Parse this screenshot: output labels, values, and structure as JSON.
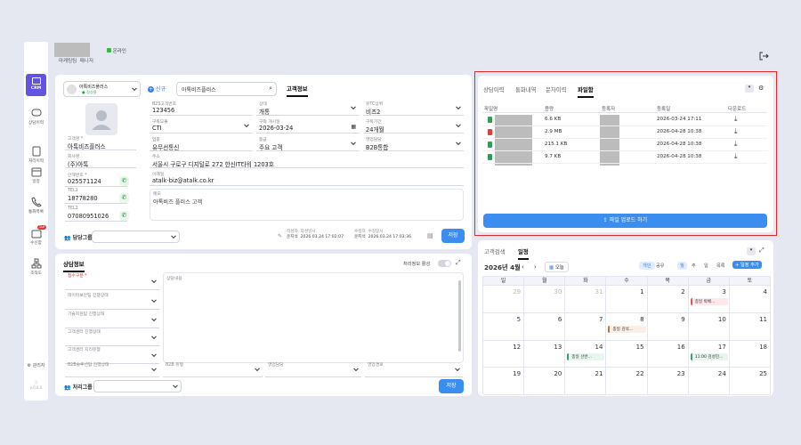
{
  "header": {
    "menu": [
      "마케팅팀",
      "매니저"
    ],
    "status": "온라인"
  },
  "sidebar": {
    "items": [
      "CRM",
      "상담이력",
      "처리이력",
      "일정",
      "통화목록",
      "수신함",
      "조직도"
    ],
    "badge": "53",
    "admin": "관리자",
    "version": "v.0.0.0"
  },
  "customer": {
    "company_select": "아톡비즈플러스",
    "company_sub": "● 정상용",
    "new_label": "신규",
    "search_value": "아톡비즈플러스",
    "tab": "고객정보",
    "fields": [
      {
        "label": "B2S고객번호",
        "value": "123456"
      },
      {
        "label": "상태",
        "value": "개통"
      },
      {
        "label": "유TC상위",
        "value": "비즈2"
      },
      {
        "label": "구독모듈",
        "value": "CTI"
      },
      {
        "label": "구독 개시일",
        "value": "2026-03-24"
      },
      {
        "label": "구독기간",
        "value": "24개월"
      },
      {
        "label": "업종",
        "value": "유무선통신"
      },
      {
        "label": "등급",
        "value": "주요 고객"
      },
      {
        "label": "영업담당",
        "value": "B2B통합"
      }
    ],
    "name_label": "고객명 *",
    "name": "아톡비즈플러스",
    "company_label": "회사명",
    "company": "(주)아톡",
    "phone_label": "안해번호 *",
    "phone": "025571124",
    "tel1_label": "TEL1",
    "tel1": "18778280",
    "tel2_label": "TEL2",
    "tel2": "07080951026",
    "address_label": "주소",
    "address": "서울시 구로구 디지털로 272 한신IT타워 1203호",
    "email_label": "이메일",
    "email": "atalk-biz@atalk.co.kr",
    "memo_label": "메모",
    "memo": "아톡비즈 플러스 고객",
    "group_label": "담당그룹",
    "reg_label": "작성자",
    "reg_sub": "작성일시",
    "reg_user": "운지석",
    "reg_date": "2026.03.24 17:02:07",
    "mod_label": "수정자",
    "mod_sub": "수정일시",
    "mod_user": "운지석",
    "mod_date": "2026.03.24 17:03:36",
    "save": "저장"
  },
  "consult": {
    "title": "상담정보",
    "toggle_label": "처리정보 활성",
    "fields": [
      "접수구분 *",
      "데이터보안팀 진행상태",
      "기술지원팀 진행상태",
      "고객센터 진행상태",
      "고객센터 지리유형"
    ],
    "content_label": "상담내용",
    "bottom": [
      "B2B솔루션팀 진행상태",
      "B2B 유형",
      "영업담당",
      "영업경로"
    ],
    "group_label": "처리그룹",
    "save": "저장"
  },
  "files": {
    "tabs": [
      "상담이력",
      "통화내역",
      "문자이력",
      "파일함"
    ],
    "active_tab": "파일함",
    "columns": [
      "파일명",
      "용량",
      "등록자",
      "등록일",
      "다운로드"
    ],
    "rows": [
      {
        "size": "6.6 KB",
        "date": "2026-03-24 17:11",
        "color": "#2e9b57"
      },
      {
        "size": "2.9 MB",
        "date": "2026-04-28 10:38",
        "color": "#d9413a"
      },
      {
        "size": "215.1 KB",
        "date": "2026-04-28 10:38",
        "color": "#2e9b57"
      },
      {
        "size": "9.7 KB",
        "date": "2026-04-28 10:38",
        "color": "#2e9b57"
      }
    ],
    "upload": "파일 업로드 하기"
  },
  "calendar": {
    "tabs": [
      "고객검색",
      "일정"
    ],
    "active_tab": "일정",
    "month": "2026년 4월",
    "today": "오늘",
    "view_scope": [
      "개인",
      "공유"
    ],
    "views": [
      "월",
      "주",
      "일",
      "목록"
    ],
    "add": "일정 추가",
    "weekdays": [
      "일",
      "월",
      "화",
      "수",
      "목",
      "금",
      "토"
    ],
    "weeks": [
      [
        "29",
        "30",
        "31",
        "1",
        "2",
        "3",
        "4"
      ],
      [
        "5",
        "6",
        "7",
        "8",
        "9",
        "10",
        "11"
      ],
      [
        "12",
        "13",
        "14",
        "15",
        "16",
        "17",
        "18"
      ],
      [
        "19",
        "20",
        "21",
        "22",
        "23",
        "24",
        "25"
      ]
    ],
    "events": [
      {
        "week": 0,
        "day": 5,
        "text": "종일 박배...",
        "bg": "#fde9ea",
        "bar": "#e1545c"
      },
      {
        "week": 1,
        "day": 3,
        "text": "종일 김석...",
        "bg": "#fbeee5",
        "bar": "#b9744a"
      },
      {
        "week": 2,
        "day": 2,
        "text": "종일 선반...",
        "bg": "#e6f6ee",
        "bar": "#34a36a"
      },
      {
        "week": 2,
        "day": 5,
        "text": "11:00 김성민...",
        "bg": "#e6f6ee",
        "bar": "#34a36a"
      }
    ]
  }
}
